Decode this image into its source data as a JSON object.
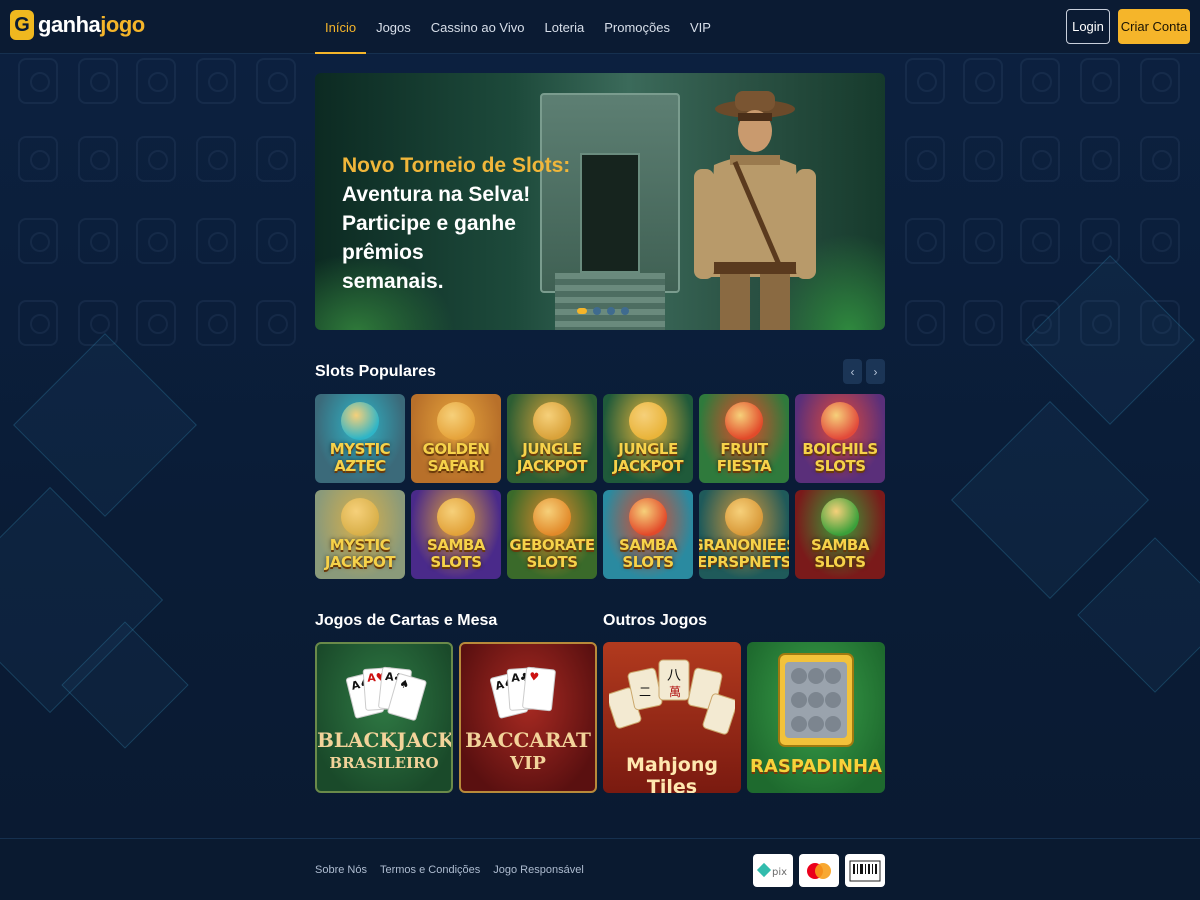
{
  "brand": {
    "logo_mark": "G",
    "name_part1": "ganha",
    "name_part2": "jogo"
  },
  "nav": {
    "items": [
      {
        "label": "Início",
        "active": true
      },
      {
        "label": "Jogos",
        "active": false
      },
      {
        "label": "Cassino ao Vivo",
        "active": false
      },
      {
        "label": "Loteria",
        "active": false
      },
      {
        "label": "Promoções",
        "active": false
      },
      {
        "label": "VIP",
        "active": false
      }
    ],
    "login_label": "Login",
    "signup_label": "Criar Conta"
  },
  "hero": {
    "headline": "Novo Torneio de Slots:",
    "line2": "Aventura na Selva!",
    "line3": "Participe e ganhe prêmios",
    "line4": "semanais.",
    "slides": 4,
    "active_slide": 1
  },
  "slots_section": {
    "title": "Slots Populares",
    "prev_icon": "‹",
    "next_icon": "›",
    "games": [
      {
        "title": "MYSTIC\nAZTEC",
        "bg": "#3b6a7a",
        "accent": "#2fb5c7"
      },
      {
        "title": "GOLDEN\nSAFARI",
        "bg": "#b8702a",
        "accent": "#e6a43c"
      },
      {
        "title": "JUNGLE\nJACKPOT",
        "bg": "#2d5e33",
        "accent": "#d9a23a"
      },
      {
        "title": "JUNGLE\nJACKPOT",
        "bg": "#1f5a3a",
        "accent": "#e9b43a"
      },
      {
        "title": "FRUIT\nFIESTA",
        "bg": "#2f7a3c",
        "accent": "#e24a2a"
      },
      {
        "title": "BOICHILS\nSLOTS",
        "bg": "#5a2f7a",
        "accent": "#e24a3a"
      },
      {
        "title": "MYSTIC\nJACKPOT",
        "bg": "#8a9a7a",
        "accent": "#d9b04a"
      },
      {
        "title": "SAMBA\nSLOTS",
        "bg": "#4a2a8a",
        "accent": "#e2a23a"
      },
      {
        "title": "GEBORATE\nSLOTS",
        "bg": "#3a6a2a",
        "accent": "#e28a2a"
      },
      {
        "title": "SAMBA\nSLOTS",
        "bg": "#2a8aa0",
        "accent": "#e24a2a"
      },
      {
        "title": "GRANONIEES\nEPRSPNETS",
        "bg": "#1f5a5a",
        "accent": "#d99a3a"
      },
      {
        "title": "SAMBA\nSLOTS",
        "bg": "#7a1a1a",
        "accent": "#3aa03a"
      }
    ]
  },
  "cards_section": {
    "title": "Jogos de Cartas e Mesa"
  },
  "other_section": {
    "title": "Outros Jogos"
  },
  "table_games": [
    {
      "line1": "BLACKJACK",
      "line2": "BRASILEIRO",
      "bg": "#1d5a30"
    },
    {
      "line1": "BACCARAT",
      "line2": "VIP",
      "bg": "#7a1a1a"
    }
  ],
  "other_games": [
    {
      "label": "Mahjong Tiles",
      "bg": "#8a2a1a"
    },
    {
      "label": "RASPADINHA",
      "bg": "#2f8a3a"
    }
  ],
  "footer": {
    "links": [
      "Sobre Nós",
      "Termos e Condições",
      "Jogo Responsável"
    ],
    "payments": [
      {
        "label": "pix",
        "icon": "pix-icon"
      },
      {
        "label": "mastercard",
        "icon": "mastercard-icon"
      },
      {
        "label": "boleto",
        "icon": "barcode-icon"
      }
    ]
  },
  "colors": {
    "accent": "#f5b52a",
    "background": "#0a1b33"
  }
}
